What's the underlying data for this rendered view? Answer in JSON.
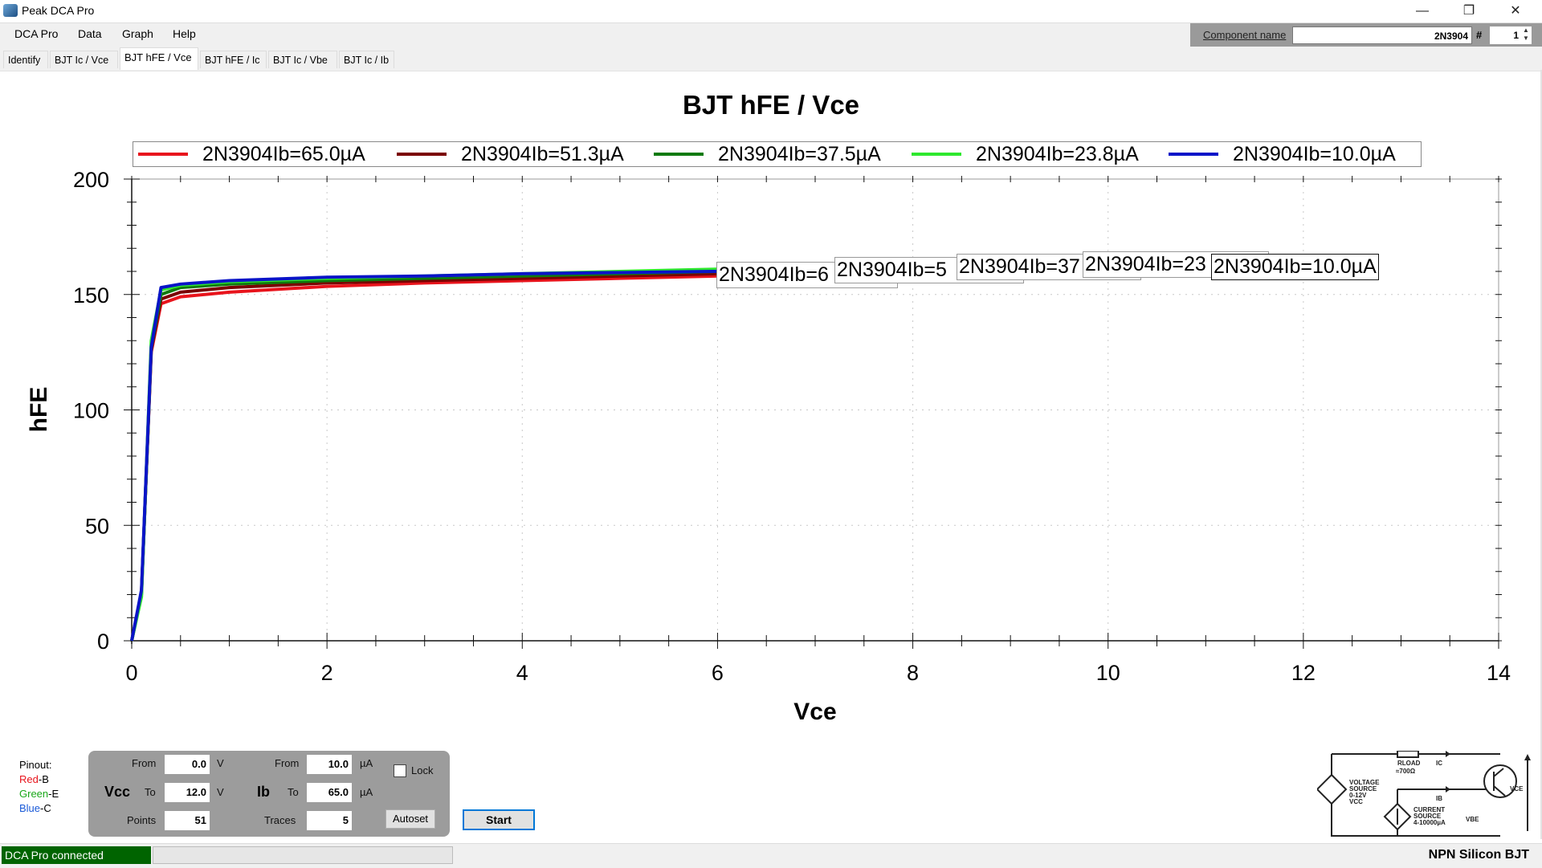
{
  "window": {
    "title": "Peak DCA Pro",
    "minimize_glyph": "—",
    "restore_glyph": "❐",
    "close_glyph": "✕"
  },
  "menu": [
    "DCA Pro",
    "Data",
    "Graph",
    "Help"
  ],
  "tabs": [
    {
      "label": "Identify",
      "active": false
    },
    {
      "label": "BJT Ic / Vce",
      "active": false
    },
    {
      "label": "BJT hFE / Vce",
      "active": true
    },
    {
      "label": "BJT hFE / Ic",
      "active": false
    },
    {
      "label": "BJT Ic / Vbe",
      "active": false
    },
    {
      "label": "BJT Ic / Ib",
      "active": false
    }
  ],
  "component": {
    "label": "Component name",
    "value": "2N3904",
    "hash": "#",
    "number": "1"
  },
  "chart_data": {
    "type": "line",
    "title": "BJT hFE / Vce",
    "xlabel": "Vce",
    "ylabel": "hFE",
    "xlim": [
      0,
      14
    ],
    "ylim": [
      0,
      200
    ],
    "xticks": [
      0,
      2,
      4,
      6,
      8,
      10,
      12,
      14
    ],
    "yticks": [
      0,
      50,
      100,
      150,
      200
    ],
    "grid": true,
    "legend_position": "top",
    "series": [
      {
        "name": "2N3904Ib=65.0µA",
        "color": "#e8141c",
        "x": [
          0,
          0.1,
          0.2,
          0.3,
          0.5,
          1,
          2,
          3,
          4,
          5,
          6
        ],
        "y": [
          0,
          21,
          125,
          146,
          149,
          151,
          153.5,
          155,
          156,
          157,
          158
        ]
      },
      {
        "name": "2N3904Ib=51.3µA",
        "color": "#7a0000",
        "x": [
          0,
          0.1,
          0.2,
          0.3,
          0.5,
          1,
          2,
          3,
          4,
          5,
          6
        ],
        "y": [
          0,
          21,
          126,
          148,
          151,
          153,
          155,
          156,
          157,
          158,
          159
        ]
      },
      {
        "name": "2N3904Ib=37.5µA",
        "color": "#0f7a0f",
        "x": [
          0,
          0.1,
          0.2,
          0.3,
          0.5,
          1,
          2,
          3,
          4,
          5,
          6
        ],
        "y": [
          0,
          20,
          127,
          150,
          153,
          154.5,
          156,
          157,
          158,
          159,
          160
        ]
      },
      {
        "name": "2N3904Ib=23.8µA",
        "color": "#2ee82e",
        "x": [
          0,
          0.1,
          0.2,
          0.3,
          0.5,
          1,
          2,
          3,
          4,
          5,
          6
        ],
        "y": [
          0,
          19,
          130,
          152,
          154,
          155.5,
          157,
          158,
          159,
          160,
          161
        ]
      },
      {
        "name": "2N3904Ib=10.0µA",
        "color": "#0a14c8",
        "x": [
          0,
          0.1,
          0.2,
          0.3,
          0.5,
          1,
          2,
          3,
          4,
          5,
          6
        ],
        "y": [
          0,
          22,
          127,
          153,
          154.5,
          156,
          157.5,
          158,
          159,
          159.5,
          160
        ]
      }
    ],
    "curve_labels": [
      "2N3904Ib=6",
      "2N3904Ib=5",
      "2N3904Ib=37",
      "2N3904Ib=23",
      "2N3904Ib=10.0µA"
    ]
  },
  "pinout": {
    "title": "Pinout:",
    "lines": [
      {
        "color_word": "Red",
        "color": "#e8141c",
        "pin": "-B"
      },
      {
        "color_word": "Green",
        "color": "#1aa81a",
        "pin": "-E"
      },
      {
        "color_word": "Blue",
        "color": "#1a5ad8",
        "pin": "-C"
      }
    ]
  },
  "controls": {
    "vcc_label": "Vcc",
    "ib_label": "Ib",
    "from_label": "From",
    "to_label": "To",
    "points_label": "Points",
    "traces_label": "Traces",
    "vcc_from": "0.0",
    "vcc_to": "12.0",
    "vcc_unit": "V",
    "ib_from": "10.0",
    "ib_to": "65.0",
    "ib_unit": "µA",
    "points": "51",
    "traces": "5",
    "lock_label": "Lock",
    "lock_checked": false,
    "autoset_label": "Autoset",
    "start_label": "Start"
  },
  "circuit": {
    "rload": "RLOAD",
    "rload_value": "≈700Ω",
    "ic": "IC",
    "ib": "IB",
    "vce": "VCE",
    "vbe": "VBE",
    "voltage_source": [
      "VOLTAGE",
      "SOURCE",
      "0-12V",
      "VCC"
    ],
    "current_source": [
      "CURRENT",
      "SOURCE",
      "4-10000µA"
    ]
  },
  "status": {
    "connection": "DCA Pro connected",
    "device_type": "NPN Silicon BJT"
  }
}
